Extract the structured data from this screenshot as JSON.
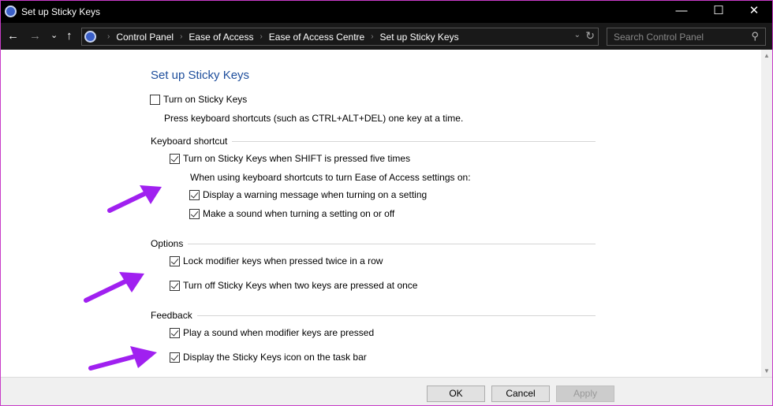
{
  "window": {
    "title": "Set up Sticky Keys",
    "controls": {
      "minimize": "—",
      "maximize": "☐",
      "close": "✕"
    }
  },
  "nav": {
    "back": "←",
    "forward": "→",
    "recent": "⌄",
    "up": "↑",
    "breadcrumbs": [
      "Control Panel",
      "Ease of Access",
      "Ease of Access Centre",
      "Set up Sticky Keys"
    ],
    "search_placeholder": "Search Control Panel"
  },
  "page": {
    "title": "Set up Sticky Keys",
    "turn_on": {
      "label": "Turn on Sticky Keys",
      "checked": false
    },
    "turn_on_desc": "Press keyboard shortcuts (such as CTRL+ALT+DEL) one key at a time.",
    "keyboard_shortcut": {
      "heading": "Keyboard shortcut",
      "shift_five": {
        "label": "Turn on Sticky Keys when SHIFT is pressed five times",
        "checked": true
      },
      "sub_heading": "When using keyboard shortcuts to turn Ease of Access settings on:",
      "warning": {
        "label": "Display a warning message when turning on a setting",
        "checked": true
      },
      "sound": {
        "label": "Make a sound when turning a setting on or off",
        "checked": true
      }
    },
    "options": {
      "heading": "Options",
      "lock": {
        "label": "Lock modifier keys when pressed twice in a row",
        "checked": true
      },
      "turn_off": {
        "label": "Turn off Sticky Keys when two keys are pressed at once",
        "checked": true
      }
    },
    "feedback": {
      "heading": "Feedback",
      "play_sound": {
        "label": "Play a sound when modifier keys are pressed",
        "checked": true
      },
      "icon": {
        "label": "Display the Sticky Keys icon on the task bar",
        "checked": true
      }
    }
  },
  "footer": {
    "ok": "OK",
    "cancel": "Cancel",
    "apply": "Apply"
  },
  "colors": {
    "annotation_arrow": "#a020f0",
    "heading": "#1e4e9c",
    "window_border": "#c83cc8"
  }
}
